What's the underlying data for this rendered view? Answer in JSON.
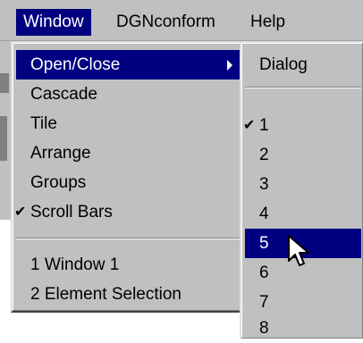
{
  "menubar": {
    "items": [
      {
        "label": "Window",
        "selected": true
      },
      {
        "label": "DGNconform",
        "selected": false
      },
      {
        "label": "Help",
        "selected": false
      }
    ]
  },
  "window_menu": {
    "items": [
      {
        "label": "Open/Close",
        "highlighted": true,
        "has_submenu": true
      },
      {
        "label": "Cascade"
      },
      {
        "label": "Tile"
      },
      {
        "label": "Arrange"
      },
      {
        "label": "Groups"
      },
      {
        "label": "Scroll Bars",
        "checked": true
      }
    ],
    "windows": [
      {
        "label": "1 Window 1"
      },
      {
        "label": "2 Element Selection"
      }
    ]
  },
  "open_close_submenu": {
    "items": [
      {
        "label": "Dialog"
      },
      {
        "label": "1",
        "checked": true
      },
      {
        "label": "2"
      },
      {
        "label": "3"
      },
      {
        "label": "4"
      },
      {
        "label": "5",
        "highlighted": true
      },
      {
        "label": "6"
      },
      {
        "label": "7"
      },
      {
        "label": "8"
      }
    ]
  },
  "colors": {
    "menu_background": "#c0c0c0",
    "highlight": "#000080",
    "highlight_text": "#ffffff"
  },
  "icons": {
    "check": "check-icon",
    "submenu_arrow": "submenu-arrow-icon",
    "cursor": "mouse-pointer-icon"
  }
}
